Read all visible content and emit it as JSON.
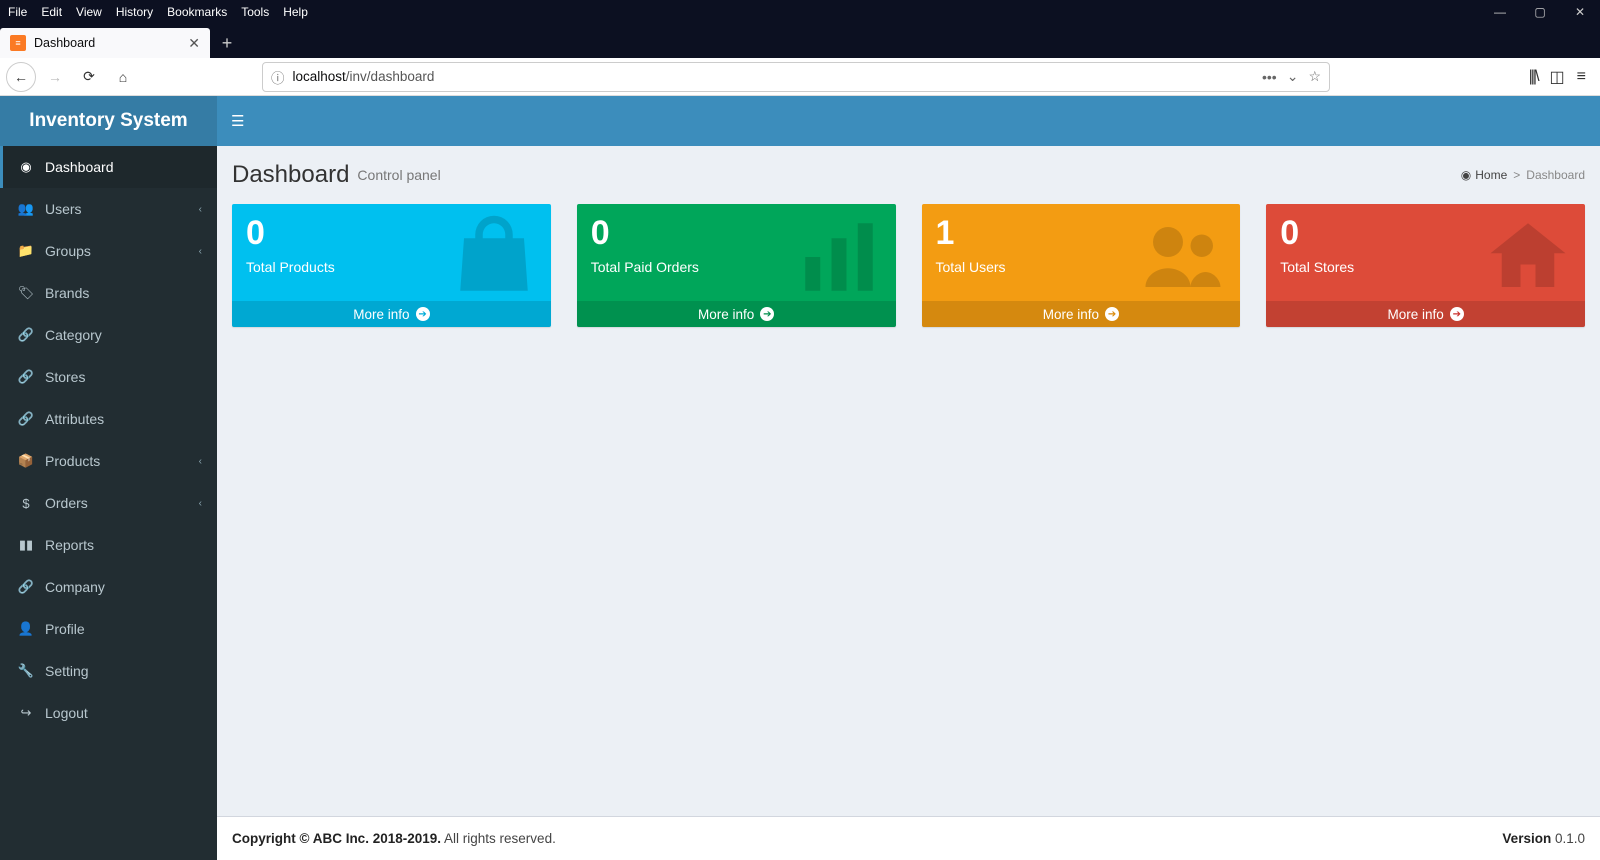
{
  "browser": {
    "menus": [
      "File",
      "Edit",
      "View",
      "History",
      "Bookmarks",
      "Tools",
      "Help"
    ],
    "tab_title": "Dashboard",
    "url_proto_host": "localhost",
    "url_path": "/inv/dashboard"
  },
  "app": {
    "brand": "Inventory System",
    "sidebar": [
      {
        "icon": "◉",
        "label": "Dashboard",
        "expand": false,
        "active": true
      },
      {
        "icon": "👥",
        "label": "Users",
        "expand": true,
        "active": false
      },
      {
        "icon": "📁",
        "label": "Groups",
        "expand": true,
        "active": false
      },
      {
        "icon": "🏷",
        "label": "Brands",
        "expand": false,
        "active": false
      },
      {
        "icon": "🔗",
        "label": "Category",
        "expand": false,
        "active": false
      },
      {
        "icon": "🔗",
        "label": "Stores",
        "expand": false,
        "active": false
      },
      {
        "icon": "🔗",
        "label": "Attributes",
        "expand": false,
        "active": false
      },
      {
        "icon": "📦",
        "label": "Products",
        "expand": true,
        "active": false
      },
      {
        "icon": "$",
        "label": "Orders",
        "expand": true,
        "active": false
      },
      {
        "icon": "▮▮",
        "label": "Reports",
        "expand": false,
        "active": false
      },
      {
        "icon": "🔗",
        "label": "Company",
        "expand": false,
        "active": false
      },
      {
        "icon": "👤",
        "label": "Profile",
        "expand": false,
        "active": false
      },
      {
        "icon": "🔧",
        "label": "Setting",
        "expand": false,
        "active": false
      },
      {
        "icon": "↪",
        "label": "Logout",
        "expand": false,
        "active": false
      }
    ],
    "header": {
      "title": "Dashboard",
      "subtitle": "Control panel",
      "breadcrumb_home": "Home",
      "breadcrumb_current": "Dashboard"
    },
    "boxes": [
      {
        "value": "0",
        "label": "Total Products",
        "link": "More info",
        "color": "aqua",
        "icon": "bag"
      },
      {
        "value": "0",
        "label": "Total Paid Orders",
        "link": "More info",
        "color": "green",
        "icon": "bars"
      },
      {
        "value": "1",
        "label": "Total Users",
        "link": "More info",
        "color": "yellow",
        "icon": "users"
      },
      {
        "value": "0",
        "label": "Total Stores",
        "link": "More info",
        "color": "red",
        "icon": "home"
      }
    ],
    "footer": {
      "copyright_bold": "Copyright © ABC Inc. 2018-2019.",
      "copyright_rest": " All rights reserved.",
      "version_label": "Version",
      "version": " 0.1.0"
    }
  }
}
